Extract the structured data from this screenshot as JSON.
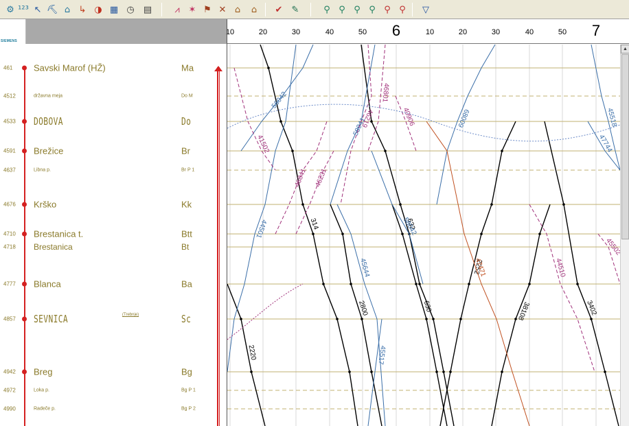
{
  "toolbar": {
    "buttons": [
      {
        "id": "tool-1",
        "glyph": "⚙",
        "color": "#2a7aa0"
      },
      {
        "id": "tool-2",
        "glyph": "¹²³",
        "color": "#2a7aa0"
      },
      {
        "id": "tool-3",
        "glyph": "↖",
        "color": "#2a5aa0"
      },
      {
        "id": "tool-4",
        "glyph": "⛏",
        "color": "#1a5aa0"
      },
      {
        "id": "tool-5",
        "glyph": "⌂",
        "color": "#2a7aa0"
      },
      {
        "id": "tool-6",
        "glyph": "↳",
        "color": "#c04020"
      },
      {
        "id": "tool-7",
        "glyph": "◑",
        "color": "#c03020"
      },
      {
        "id": "tool-8",
        "glyph": "▦",
        "color": "#2a5aa0"
      },
      {
        "id": "tool-9",
        "glyph": "◷",
        "color": "#404040"
      },
      {
        "id": "tool-10",
        "glyph": "▤",
        "color": "#404040"
      },
      {
        "id": "tool-11",
        "glyph": "⩘",
        "color": "#c03060"
      },
      {
        "id": "tool-12",
        "glyph": "✶",
        "color": "#c03060"
      },
      {
        "id": "tool-13",
        "glyph": "⚑",
        "color": "#a04020"
      },
      {
        "id": "tool-14",
        "glyph": "✕",
        "color": "#a04020"
      },
      {
        "id": "tool-15",
        "glyph": "⌂",
        "color": "#a06020"
      },
      {
        "id": "tool-16",
        "glyph": "⌂",
        "color": "#a06020"
      },
      {
        "id": "tool-17",
        "glyph": "✔",
        "color": "#c03030"
      },
      {
        "id": "tool-18",
        "glyph": "✎",
        "color": "#207050"
      },
      {
        "id": "tool-19",
        "glyph": "⚲",
        "color": "#208060"
      },
      {
        "id": "tool-20",
        "glyph": "⚲",
        "color": "#208060"
      },
      {
        "id": "tool-21",
        "glyph": "⚲",
        "color": "#208060"
      },
      {
        "id": "tool-22",
        "glyph": "⚲",
        "color": "#208060"
      },
      {
        "id": "tool-23",
        "glyph": "⚲",
        "color": "#c03030"
      },
      {
        "id": "tool-24",
        "glyph": "⚲",
        "color": "#c03030"
      },
      {
        "id": "tool-25",
        "glyph": "▽",
        "color": "#2050a0"
      }
    ]
  },
  "logo": {
    "text": "SIEMENS"
  },
  "time_axis": {
    "ticks": [
      {
        "label": "10",
        "hour": false
      },
      {
        "label": "20",
        "hour": false
      },
      {
        "label": "30",
        "hour": false
      },
      {
        "label": "40",
        "hour": false
      },
      {
        "label": "50",
        "hour": false
      },
      {
        "label": "6",
        "hour": true
      },
      {
        "label": "10",
        "hour": false
      },
      {
        "label": "20",
        "hour": false
      },
      {
        "label": "30",
        "hour": false
      },
      {
        "label": "40",
        "hour": false
      },
      {
        "label": "50",
        "hour": false
      },
      {
        "label": "7",
        "hour": true
      }
    ]
  },
  "stations": [
    {
      "km": "461",
      "name": "Savski Marof (HŽ)",
      "abbr": "Ma",
      "style": "main",
      "dot": true
    },
    {
      "km": "4512",
      "name": "državna meja",
      "abbr": "Do M",
      "style": "minor",
      "dot": false
    },
    {
      "km": "4533",
      "name": "DOBOVA",
      "abbr": "Do",
      "style": "big",
      "dot": true
    },
    {
      "km": "4591",
      "name": "Brežice",
      "abbr": "Br",
      "style": "main",
      "dot": true
    },
    {
      "km": "4637",
      "name": "Libna p.",
      "abbr": "Br P 1",
      "style": "minor",
      "dot": false
    },
    {
      "km": "4676",
      "name": "Krško",
      "abbr": "Kk",
      "style": "main",
      "dot": true
    },
    {
      "km": "4710",
      "name": "Brestanica t.",
      "abbr": "Btt",
      "style": "main",
      "dot": true
    },
    {
      "km": "4718",
      "name": "Brestanica",
      "abbr": "Bt",
      "style": "main-sub",
      "dot": false
    },
    {
      "km": "4777",
      "name": "Blanca",
      "abbr": "Ba",
      "style": "main",
      "dot": true
    },
    {
      "km": "4857",
      "name": "SEVNICA",
      "abbr": "Sc",
      "style": "big",
      "dot": true
    },
    {
      "km": "4942",
      "name": "Breg",
      "abbr": "Bg",
      "style": "main",
      "dot": true
    },
    {
      "km": "4972",
      "name": "Loka p.",
      "abbr": "Bg P 1",
      "style": "minor",
      "dot": false
    },
    {
      "km": "4990",
      "name": "Radeče p.",
      "abbr": "Bg P 2",
      "style": "minor",
      "dot": false
    }
  ],
  "sevnica_remark": "(Trebnje)",
  "trains": [
    {
      "number": "41502",
      "color": "#a0307a"
    },
    {
      "number": "44501",
      "color": "#3a6ea8"
    },
    {
      "number": "314",
      "color": "#000000"
    },
    {
      "number": "46219",
      "color": "#a0307a"
    },
    {
      "number": "46801",
      "color": "#a0307a"
    },
    {
      "number": "40906",
      "color": "#a0307a"
    },
    {
      "number": "68009",
      "color": "#3a6ea8"
    },
    {
      "number": "45518",
      "color": "#3a6ea8"
    },
    {
      "number": "56042",
      "color": "#3a6ea8"
    },
    {
      "number": "58041",
      "color": "#3a6ea8"
    },
    {
      "number": "58042",
      "color": "#3a6ea8"
    },
    {
      "number": "47744",
      "color": "#3a6ea8"
    },
    {
      "number": "46841",
      "color": "#a0307a"
    },
    {
      "number": "46231",
      "color": "#a0307a"
    },
    {
      "number": "2800",
      "color": "#000000"
    },
    {
      "number": "45644",
      "color": "#3a6ea8"
    },
    {
      "number": "632",
      "color": "#000000"
    },
    {
      "number": "2252",
      "color": "#000000"
    },
    {
      "number": "47471",
      "color": "#c05020"
    },
    {
      "number": "44510",
      "color": "#a0307a"
    },
    {
      "number": "45502",
      "color": "#a0307a"
    },
    {
      "number": "630",
      "color": "#000000"
    },
    {
      "number": "45517",
      "color": "#3a6ea8"
    },
    {
      "number": "2220",
      "color": "#000000"
    },
    {
      "number": "38108",
      "color": "#000000"
    },
    {
      "number": "3402",
      "color": "#000000"
    }
  ],
  "colors": {
    "station_text": "#8a7a2a",
    "station_line": "#c2b070",
    "station_dot": "#d42020",
    "freight_line": "#3a6ea8",
    "passenger_line": "#000000",
    "dashed_line": "#a0307a",
    "orange_line": "#c05020"
  }
}
